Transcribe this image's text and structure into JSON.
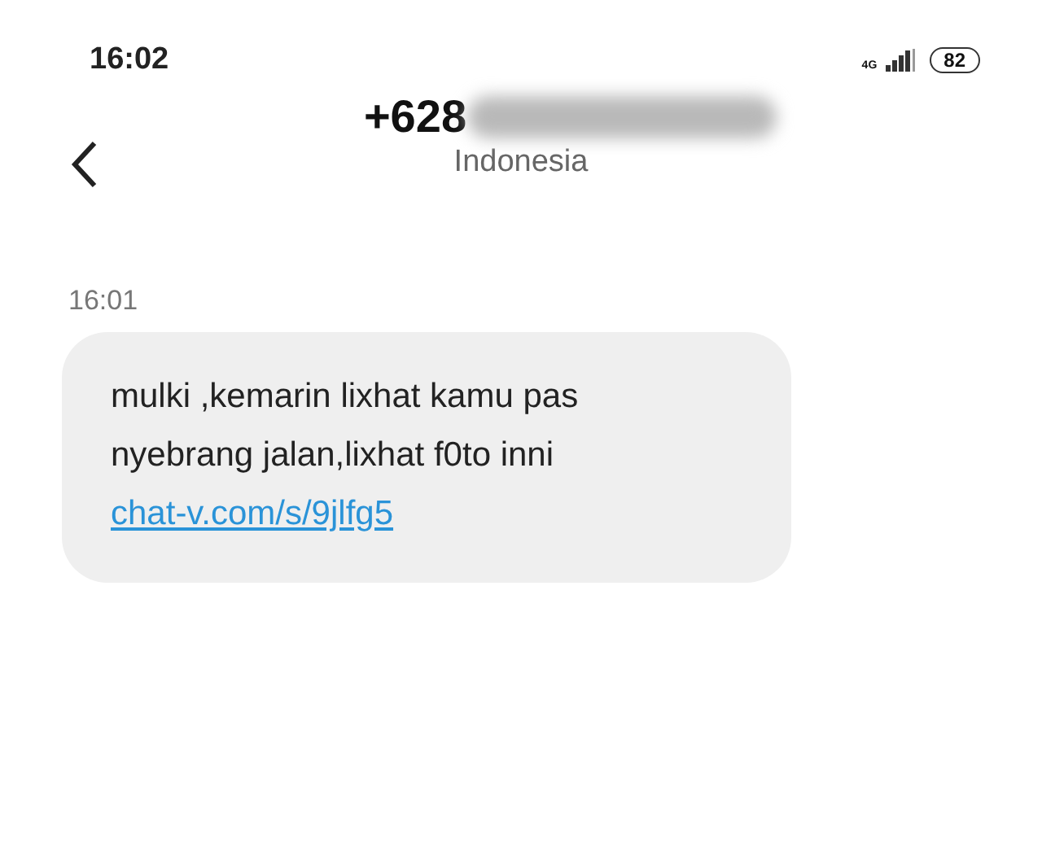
{
  "status_bar": {
    "time": "16:02",
    "network": "4G",
    "battery": "82"
  },
  "header": {
    "title": "+628",
    "subtitle": "Indonesia"
  },
  "messages": [
    {
      "time": "16:01",
      "lines": [
        "mulki ,kemarin lixhat kamu pas",
        "nyebrang jalan,lixhat f0to inni"
      ],
      "link": "chat-v.com/s/9jlfg5"
    }
  ]
}
